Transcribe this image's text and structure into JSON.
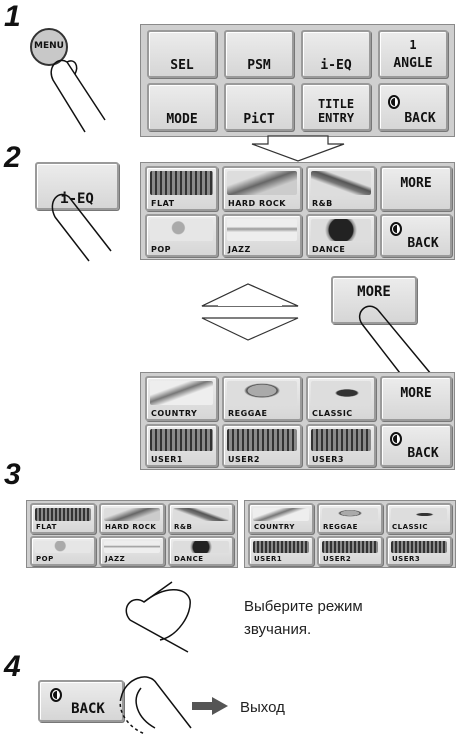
{
  "steps": [
    "1",
    "2",
    "3",
    "4"
  ],
  "menu_button": "MENU",
  "step1_menu": {
    "row1": [
      "SEL",
      "PSM",
      "i-EQ",
      "ANGLE"
    ],
    "row1_badge": "1",
    "row2": [
      "MODE",
      "PiCT",
      "TITLE",
      "ENTRY",
      "BACK"
    ]
  },
  "ieq_button": "i-EQ",
  "ieq_page1": {
    "items": [
      "FLAT",
      "HARD ROCK",
      "R&B",
      "POP",
      "JAZZ",
      "DANCE"
    ],
    "more": "MORE",
    "back": "BACK"
  },
  "more_button": "MORE",
  "ieq_page2": {
    "items": [
      "COUNTRY",
      "REGGAE",
      "CLASSIC",
      "USER1",
      "USER2",
      "USER3"
    ],
    "more": "MORE",
    "back": "BACK"
  },
  "step3_text": [
    "Выберите режим",
    "звучания."
  ],
  "back_button": "BACK",
  "exit_text": "Выход"
}
